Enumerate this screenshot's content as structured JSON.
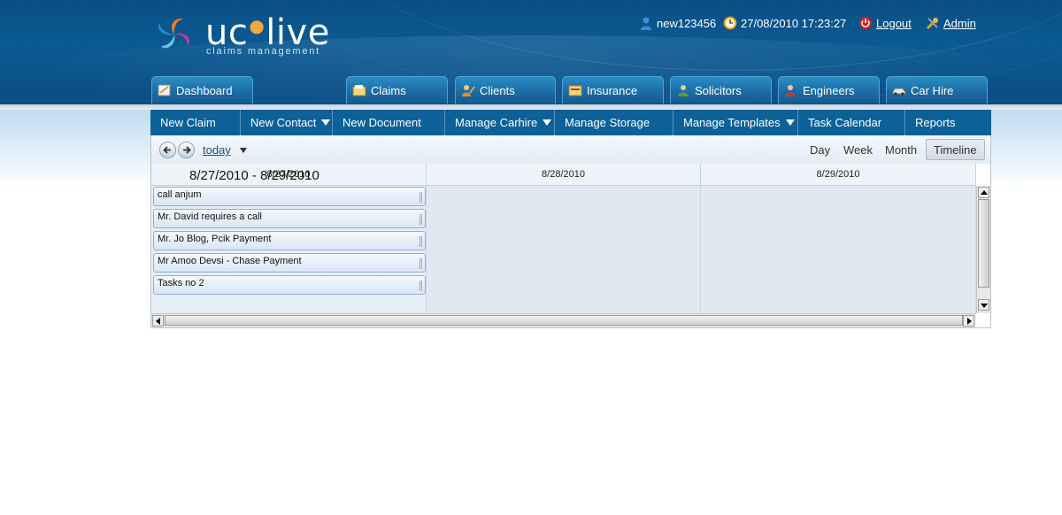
{
  "header": {
    "logo_text_left": "uc",
    "logo_text_right": "live",
    "logo_subtitle": "claims management",
    "user_name": "new123456",
    "datetime": "27/08/2010 17:23:27",
    "logout_label": "Logout",
    "admin_label": "Admin"
  },
  "tabs": [
    {
      "label": "Dashboard",
      "icon": "dashboard-icon"
    },
    {
      "label": "Claims",
      "icon": "claims-icon"
    },
    {
      "label": "Clients",
      "icon": "clients-icon"
    },
    {
      "label": "Insurance",
      "icon": "insurance-icon"
    },
    {
      "label": "Solicitors",
      "icon": "solicitors-icon"
    },
    {
      "label": "Engineers",
      "icon": "engineers-icon"
    },
    {
      "label": "Car Hire",
      "icon": "car-icon"
    }
  ],
  "menu": [
    {
      "label": "New Claim",
      "dropdown": false
    },
    {
      "label": "New Contact",
      "dropdown": true
    },
    {
      "label": "New Document",
      "dropdown": false
    },
    {
      "label": "Manage Carhire",
      "dropdown": true
    },
    {
      "label": "Manage Storage",
      "dropdown": false
    },
    {
      "label": "Manage Templates",
      "dropdown": true
    },
    {
      "label": "Task Calendar",
      "dropdown": false
    },
    {
      "label": "Reports",
      "dropdown": false
    }
  ],
  "scheduler": {
    "today_label": "today",
    "range_label": "8/27/2010 - 8/29/2010",
    "views": [
      "Day",
      "Week",
      "Month",
      "Timeline"
    ],
    "active_view": "Timeline",
    "days": [
      "8/27/2010",
      "8/28/2010",
      "8/29/2010"
    ],
    "appointments": [
      "call anjum",
      "Mr. David requires a call",
      "Mr. Jo Blog, Pcik Payment",
      "Mr Amoo Devsi - Chase Payment",
      "Tasks no 2"
    ]
  },
  "colors": {
    "header_blue": "#0b5a93",
    "menu_blue": "#0d6199",
    "accent_orange": "#f2a73a"
  }
}
